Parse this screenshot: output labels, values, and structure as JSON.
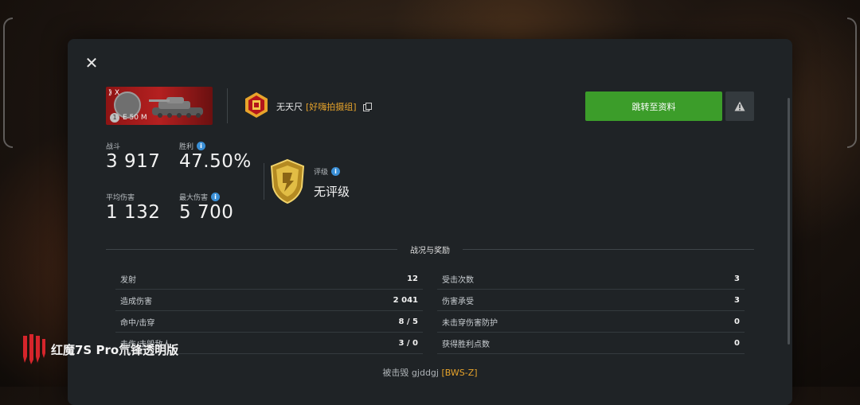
{
  "dialog": {
    "close_glyph": "✕"
  },
  "tank": {
    "tier_glyph": "X",
    "tier_number": "1",
    "name": "E 50 M"
  },
  "player": {
    "name": "无天尺",
    "clan_tag": "[好嗨拍摄组]"
  },
  "actions": {
    "profile_label": "跳转至资料",
    "report_icon": "warning-icon"
  },
  "stats": {
    "battles_label": "战斗",
    "battles_value": "3 917",
    "winrate_label": "胜利",
    "winrate_value": "47.50%",
    "avg_damage_label": "平均伤害",
    "avg_damage_value": "1 132",
    "max_damage_label": "最大伤害",
    "max_damage_value": "5 700"
  },
  "rating": {
    "label": "评级",
    "value": "无评级"
  },
  "section": {
    "title": "战况与奖励"
  },
  "battle_rows": [
    {
      "left_key": "发射",
      "left_val": "12",
      "right_key": "受击次数",
      "right_val": "3"
    },
    {
      "left_key": "造成伤害",
      "left_val": "2 041",
      "right_key": "伤害承受",
      "right_val": "3"
    },
    {
      "left_key": "命中/击穿",
      "left_val": "8 / 5",
      "right_key": "未击穿伤害防护",
      "right_val": "0"
    },
    {
      "left_key": "击伤/击毁敌人",
      "left_val": "3 / 0",
      "right_key": "获得胜利点数",
      "right_val": "0"
    }
  ],
  "killed_by": {
    "prefix": "被击毁",
    "player": "gjddgj",
    "clan_tag": "[BWS-Z]"
  },
  "watermark": {
    "text": "红魔7S Pro氘锋透明版"
  },
  "colors": {
    "accent_green": "#3c9d2a",
    "clan_orange": "#e8a42b",
    "info_blue": "#3a8fd6",
    "panel_bg": "#1f2326"
  }
}
